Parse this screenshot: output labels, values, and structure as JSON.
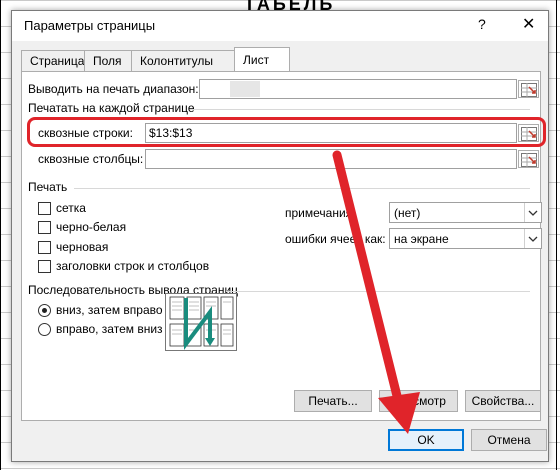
{
  "background": {
    "title": "ТАБЕЛЬ"
  },
  "dialog": {
    "title": "Параметры страницы",
    "help": "?",
    "close": "✕",
    "tabs": [
      {
        "label": "Страница"
      },
      {
        "label": "Поля"
      },
      {
        "label": "Колонтитулы"
      },
      {
        "label": "Лист",
        "active": true
      }
    ],
    "print_area": {
      "label": "Выводить на печать диапазон:",
      "value": ""
    },
    "print_titles": {
      "header": "Печатать на каждой странице",
      "rows_label": "сквозные строки:",
      "rows_value": "$13:$13",
      "cols_label": "сквозные столбцы:",
      "cols_value": ""
    },
    "print": {
      "header": "Печать",
      "checkboxes": [
        {
          "label": "сетка",
          "checked": false
        },
        {
          "label": "черно-белая",
          "checked": false
        },
        {
          "label": "черновая",
          "checked": false
        },
        {
          "label": "заголовки строк и столбцов",
          "checked": false
        }
      ],
      "comments_label": "примечания:",
      "comments_value": "(нет)",
      "errors_label": "ошибки ячеек как:",
      "errors_value": "на экране"
    },
    "page_order": {
      "header": "Последовательность вывода страниц",
      "options": [
        {
          "label": "вниз, затем вправо",
          "selected": true
        },
        {
          "label": "вправо, затем вниз",
          "selected": false
        }
      ]
    },
    "buttons": {
      "print": "Печать...",
      "preview": "Просмотр",
      "properties": "Свойства...",
      "ok": "OK",
      "cancel": "Отмена"
    },
    "colors": {
      "annotation": "#e0242a",
      "accent": "#0078d7"
    }
  }
}
